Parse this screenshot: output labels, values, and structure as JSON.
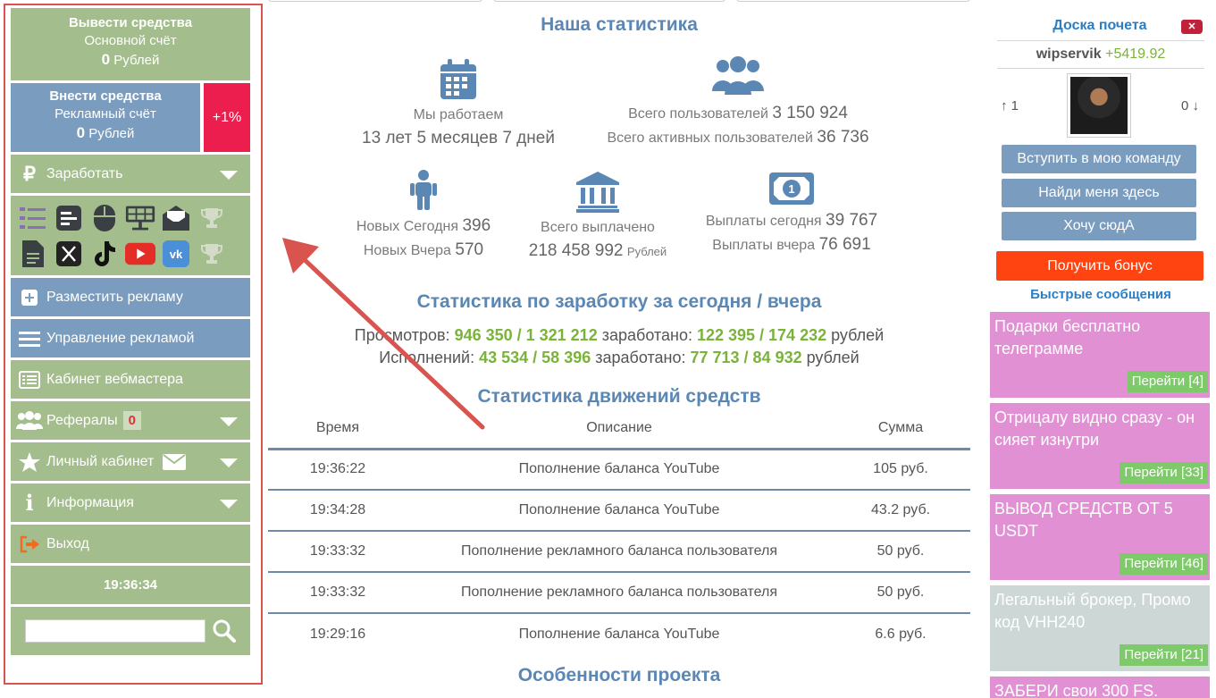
{
  "sidebar": {
    "withdraw": {
      "title": "Вывести средства",
      "account": "Основной счёт",
      "amount": "0",
      "currency": "Рублей"
    },
    "deposit": {
      "title": "Внести средства",
      "account": "Рекламный счёт",
      "amount": "0",
      "currency": "Рублей",
      "bonus": "+1%"
    },
    "earn": "Заработать",
    "place_ad": "Разместить рекламу",
    "manage_ads": "Управление рекламой",
    "webmaster": "Кабинет вебмастера",
    "referrals": "Рефералы",
    "referrals_count": "0",
    "cabinet": "Личный кабинет",
    "info": "Информация",
    "logout": "Выход",
    "time": "19:36:34",
    "search_value": ""
  },
  "stats": {
    "title": "Наша статистика",
    "working_label": "Мы работаем",
    "working_value": "13 лет 5 месяцев 7 дней",
    "users_label": "Всего пользователей",
    "users_value": "3 150 924",
    "active_label": "Всего активных пользователей",
    "active_value": "36 736",
    "new_today_label": "Новых Сегодня",
    "new_today_value": "396",
    "new_yesterday_label": "Новых Вчера",
    "new_yesterday_value": "570",
    "paid_label": "Всего выплачено",
    "paid_value": "218 458 992",
    "paid_unit": "Рублей",
    "pay_today_label": "Выплаты сегодня",
    "pay_today_value": "39 767",
    "pay_yesterday_label": "Выплаты вчера",
    "pay_yesterday_value": "76 691"
  },
  "earnings": {
    "title": "Статистика по заработку за сегодня / вчера",
    "views_label": "Просмотров:",
    "views_value": "946 350 / 1 321 212",
    "earned_label": "заработано:",
    "views_earned": "122 395 / 174 232",
    "currency": "рублей",
    "tasks_label": "Исполнений:",
    "tasks_value": "43 534 / 58 396",
    "tasks_earned": "77 713 / 84 932"
  },
  "moves": {
    "title": "Статистика движений средств",
    "columns": [
      "Время",
      "Описание",
      "Сумма"
    ],
    "rows": [
      [
        "19:36:22",
        "Пополнение баланса YouTube",
        "105 руб."
      ],
      [
        "19:34:28",
        "Пополнение баланса YouTube",
        "43.2 руб."
      ],
      [
        "19:33:32",
        "Пополнение рекламного баланса пользователя",
        "50 руб."
      ],
      [
        "19:33:32",
        "Пополнение рекламного баланса пользователя",
        "50 руб."
      ],
      [
        "19:29:16",
        "Пополнение баланса YouTube",
        "6.6 руб."
      ]
    ]
  },
  "features_title": "Особенности проекта",
  "right": {
    "honor_title": "Доска почета",
    "leader_name": "wipservik",
    "leader_amount": "+5419.92",
    "rank_up": "↑ 1",
    "rank_down": "0 ↓",
    "btn_team": "Вступить в мою команду",
    "btn_find": "Найди меня здесь",
    "btn_want": "Хочу сюдА",
    "btn_bonus": "Получить бонус",
    "quick_msgs": "Быстрые сообщения",
    "ads": [
      {
        "text": "Подарки бесплатно телеграмме",
        "go": "Перейти [4]"
      },
      {
        "text": "Отрицалу видно сразу - он сияет изнутри",
        "go": "Перейти [33]"
      },
      {
        "text": "ВЫВОД СРЕДСТВ ОТ 5 USDT",
        "go": "Перейти [46]"
      },
      {
        "text": "Легальный брокер, Промо код VHH240",
        "go": "Перейти [21]"
      },
      {
        "text": "ЗАБЕРИ свои 300 FS."
      }
    ]
  },
  "colors": {
    "sidebar_green": "#a3be8c",
    "sidebar_blue": "#7a9cbf",
    "accent_red": "#ec1e4e",
    "heading_blue": "#5b87b5",
    "value_green": "#7ab33a",
    "ad_pink": "#e190d4",
    "bonus_orange": "#ff4411",
    "annotation_red": "#d9534f"
  },
  "icons": [
    "ruble-icon",
    "plus-icon",
    "menu-icon",
    "table-icon",
    "users-icon",
    "star-icon",
    "envelope-icon",
    "info-icon",
    "logout-icon",
    "search-icon",
    "calendar-icon",
    "person-icon",
    "bank-icon",
    "money-icon",
    "trophy-icon",
    "youtube-icon",
    "vk-icon",
    "tiktok-icon",
    "x-icon",
    "mouse-icon",
    "tasks-icon",
    "doc-icon"
  ]
}
